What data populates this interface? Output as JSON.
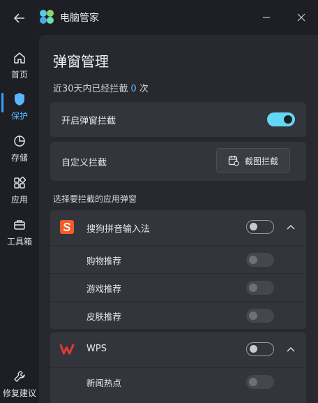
{
  "window": {
    "title": "电脑管家"
  },
  "sidebar": {
    "items": [
      {
        "label": "首页",
        "icon": "home-icon"
      },
      {
        "label": "保护",
        "icon": "shield-icon",
        "active": true
      },
      {
        "label": "存储",
        "icon": "pie-chart-icon"
      },
      {
        "label": "应用",
        "icon": "apps-icon"
      },
      {
        "label": "工具箱",
        "icon": "toolbox-icon"
      }
    ],
    "repair_label": "修复建议"
  },
  "main": {
    "title": "弹窗管理",
    "summary": {
      "prefix": "近30天内已经拦截",
      "count": "0",
      "suffix": "次"
    },
    "enable_block": {
      "label": "开启弹窗拦截",
      "on": true
    },
    "custom_block": {
      "label": "自定义拦截",
      "button_label": "截图拦截"
    },
    "section_label": "选择要拦截的应用弹窗",
    "apps": [
      {
        "name": "搜狗拼音输入法",
        "icon": "sogou-icon",
        "on": false,
        "expanded": true,
        "items": [
          {
            "label": "购物推荐",
            "on": false
          },
          {
            "label": "游戏推荐",
            "on": false
          },
          {
            "label": "皮肤推荐",
            "on": false
          }
        ]
      },
      {
        "name": "WPS",
        "icon": "wps-icon",
        "on": false,
        "expanded": true,
        "items": [
          {
            "label": "新闻热点",
            "on": false
          }
        ]
      }
    ]
  },
  "colors": {
    "accent": "#63d7f4",
    "active_nav": "#58b7ff",
    "count": "#5bb8ff",
    "sogou": "#f15a29",
    "wps": "#e53935"
  }
}
